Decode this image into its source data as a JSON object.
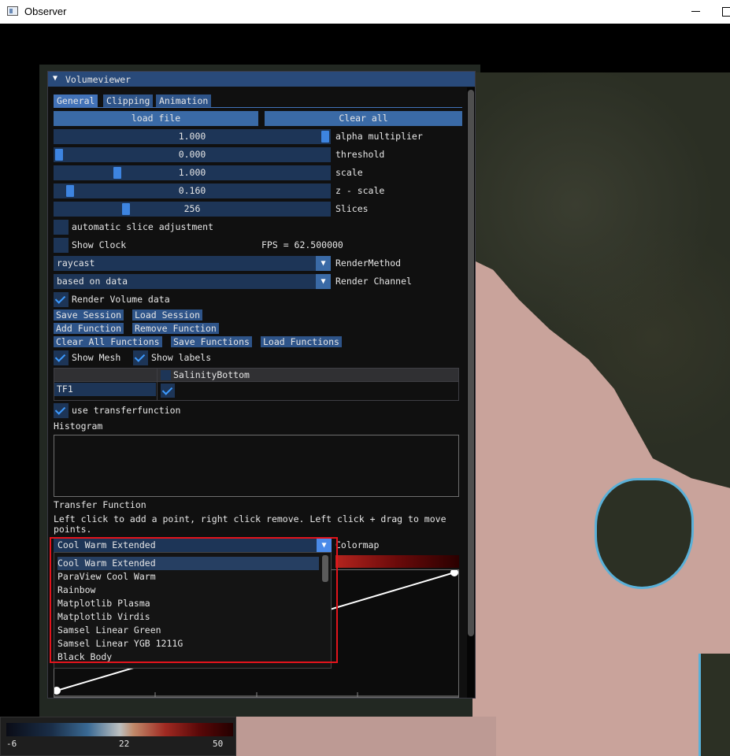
{
  "window": {
    "title": "Observer"
  },
  "panel": {
    "title": "Volumeviewer",
    "tabs": [
      "General",
      "Clipping",
      "Animation"
    ],
    "buttons": {
      "load_file": "load file",
      "clear_all": "Clear all"
    },
    "sliders": [
      {
        "value": "1.000",
        "label": "alpha multiplier",
        "fraction": 1.0
      },
      {
        "value": "0.000",
        "label": "threshold",
        "fraction": 0.0
      },
      {
        "value": "1.000",
        "label": "scale",
        "fraction": 0.22
      },
      {
        "value": "0.160",
        "label": "z - scale",
        "fraction": 0.04
      },
      {
        "value": "256",
        "label": "Slices",
        "fraction": 0.25
      }
    ],
    "auto_slice": {
      "label": "automatic slice adjustment",
      "checked": false
    },
    "show_clock": {
      "label": "Show Clock",
      "checked": false
    },
    "fps": "FPS = 62.500000",
    "render_method": {
      "value": "raycast",
      "label": "RenderMethod"
    },
    "render_channel": {
      "value": "based on data",
      "label": "Render Channel"
    },
    "render_volume": {
      "label": "Render Volume data",
      "checked": true
    },
    "session_buttons": {
      "save_session": "Save Session",
      "load_session": "Load Session",
      "add_function": "Add Function",
      "remove_function": "Remove Function",
      "clear_all_functions": "Clear All Functions",
      "save_functions": "Save Functions",
      "load_functions": "Load Functions"
    },
    "show_mesh": {
      "label": "Show Mesh",
      "checked": true
    },
    "show_labels": {
      "label": "Show labels",
      "checked": true
    },
    "table": {
      "column": "SalinityBottom",
      "row": "TF1",
      "checked": true
    },
    "use_tf": {
      "label": "use transferfunction",
      "checked": true
    },
    "histogram_label": "Histogram",
    "tf_label": "Transfer Function",
    "tf_help": "Left click to add a point, right click remove. Left click + drag to move points.",
    "colormap": {
      "value": "Cool Warm Extended",
      "label": "Colormap",
      "options": [
        "Cool Warm Extended",
        "ParaView Cool Warm",
        "Rainbow",
        "Matplotlib Plasma",
        "Matplotlib Virdis",
        "Samsel Linear Green",
        "Samsel Linear YGB 1211G",
        "Black Body"
      ]
    }
  },
  "legend": {
    "min": "-6",
    "mid": "22",
    "max": "50"
  },
  "colors": {
    "accent": "#3d84e0",
    "header": "#294a7a",
    "highlight": "#e3141c"
  }
}
